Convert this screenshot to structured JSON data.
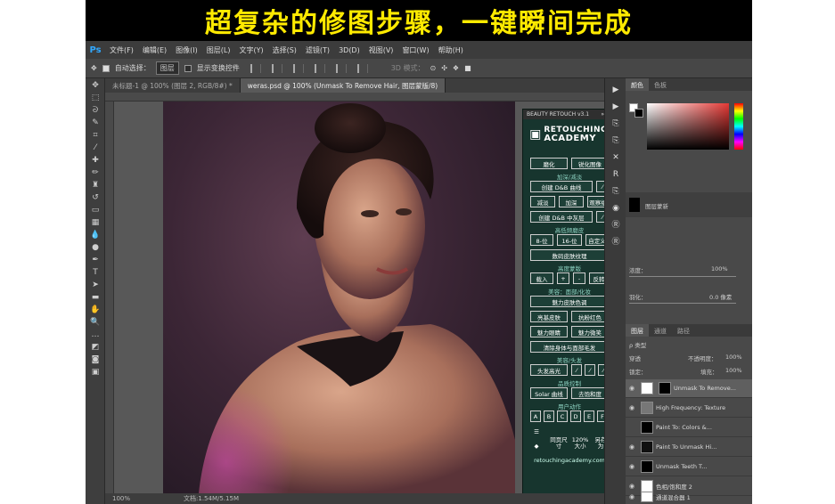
{
  "banner": {
    "text": "超复杂的修图步骤，一键瞬间完成",
    "color": "#ffea00"
  },
  "app": {
    "logo": "Ps",
    "menus": [
      "文件(F)",
      "编辑(E)",
      "图像(I)",
      "图层(L)",
      "文字(Y)",
      "选择(S)",
      "滤镜(T)",
      "3D(D)",
      "视图(V)",
      "窗口(W)",
      "帮助(H)"
    ]
  },
  "options": {
    "auto_select_label": "自动选择：",
    "auto_select_value": "图层",
    "show_transform_label": "显示变换控件",
    "mode_3d_label": "3D 模式："
  },
  "tabs": [
    {
      "label": "未标题-1 @ 100% (图层 2, RGB/8#) *"
    },
    {
      "label": "weras.psd @ 100% (Unmask To Remove Hair, 图层蒙版/8)"
    }
  ],
  "status": {
    "zoom": "100%",
    "doc": "文档:1.54M/5.15M"
  },
  "plugin": {
    "title": "BEAUTY RETOUCH v3.1",
    "brand_line1": "RETOUCHING",
    "brand_line2": "ACADEMY",
    "btn_soften": "磨化",
    "btn_sharpen_image": "锐化图像",
    "sec_dodge_burn": "加深/减淡",
    "btn_create_db_curve": "创建 D&B 曲线",
    "btn_lighten": "减淡",
    "btn_darken": "加深",
    "btn_observe": "观察组",
    "btn_create_db_gray": "创建 D&B 中灰层",
    "sec_freq": "高低频磨皮",
    "btn_8bit": "8-位",
    "btn_16bit": "16-位",
    "btn_custom": "自定义",
    "btn_digital_skin": "数码皮肤纹理",
    "sec_highlight_mask": "高度蒙版",
    "btn_load": "载入",
    "btn_plus": "+",
    "btn_minus": "-",
    "btn_invert": "反转",
    "sec_beauty_face": "美容：面部/化妆",
    "btn_glamour_skin": "魅力皮肤色调",
    "btn_bright_skin": "亮基皮肤",
    "btn_anti_red": "抗粉红色",
    "btn_glam_eyes": "魅力眼睛",
    "btn_glam_lips": "魅力微笑",
    "btn_remove_hair": "清除身体与面部毛发",
    "sec_beauty_hair": "美容/头发",
    "btn_hair_highlight": "头发高光",
    "sec_quality": "品质控制",
    "btn_solar_curve": "Solar 曲线",
    "btn_desaturate": "去饱和度",
    "sec_user_action": "用户动作",
    "actions": [
      "A",
      "B",
      "C",
      "D",
      "E",
      "F"
    ],
    "bottom_btn1": "同页尺寸",
    "bottom_btn2": "120%大小",
    "bottom_btn3": "另存为",
    "url": "retouchingacademy.com"
  },
  "panels": {
    "color_tabs": [
      "颜色",
      "色板"
    ],
    "adjust_label": "图层蒙新",
    "density_label": "浓度：",
    "density_value": "100%",
    "feather_label": "羽化：",
    "feather_value": "0.0 像素",
    "layer_tabs": [
      "图层",
      "通道",
      "路径"
    ],
    "kind_label": "ρ 类型",
    "blend_mode": "穿透",
    "opacity_label": "不透明度：",
    "opacity_value": "100%",
    "lock_label": "锁定：",
    "fill_label": "填充：",
    "fill_value": "100%",
    "layers": [
      {
        "name": "Unmask To Remove..."
      },
      {
        "name": "High Frequency: Texture"
      },
      {
        "name": "Paint To: Colors &..."
      },
      {
        "name": "Paint To Unmask Hi..."
      },
      {
        "name": "Unmask Teeth T..."
      },
      {
        "name": "色相/饱和度 2"
      },
      {
        "name": "通道混合器 1"
      }
    ]
  }
}
